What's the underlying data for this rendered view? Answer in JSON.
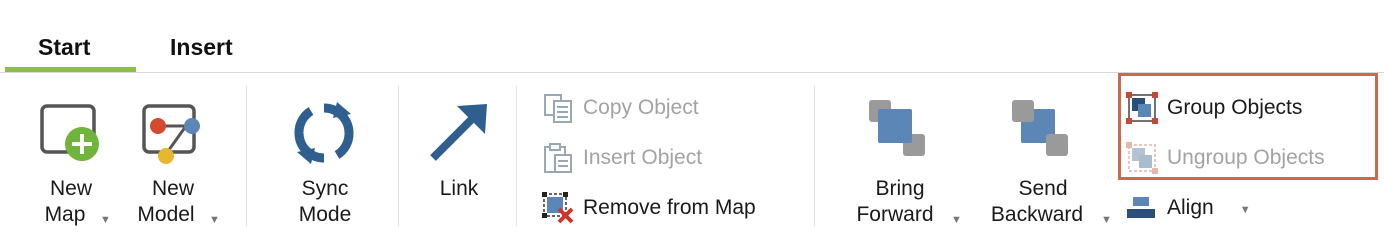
{
  "tabs": [
    {
      "label": "Start",
      "active": true
    },
    {
      "label": "Insert",
      "active": false
    }
  ],
  "colors": {
    "accent": "#8cbf4a",
    "highlight": "#d0674a",
    "icon_blue": "#2f5f8f",
    "disabled": "#a3a3a3"
  },
  "ribbon": {
    "new_map": {
      "line1": "New",
      "line2": "Map",
      "icon": "new-map-icon"
    },
    "new_model": {
      "line1": "New",
      "line2": "Model",
      "icon": "new-model-icon"
    },
    "sync_mode": {
      "line1": "Sync",
      "line2": "Mode",
      "icon": "sync-icon"
    },
    "link": {
      "label": "Link",
      "icon": "link-arrow-icon"
    },
    "copy_object": {
      "label": "Copy Object",
      "enabled": false,
      "icon": "copy-object-icon"
    },
    "insert_object": {
      "label": "Insert Object",
      "enabled": false,
      "icon": "insert-object-icon"
    },
    "remove_from_map": {
      "label": "Remove from Map",
      "enabled": true,
      "icon": "remove-from-map-icon"
    },
    "bring_forward": {
      "line1": "Bring",
      "line2": "Forward",
      "icon": "bring-forward-icon"
    },
    "send_backward": {
      "line1": "Send",
      "line2": "Backward",
      "icon": "send-backward-icon"
    },
    "group_objects": {
      "label": "Group Objects",
      "enabled": true,
      "icon": "group-objects-icon"
    },
    "ungroup_objects": {
      "label": "Ungroup Objects",
      "enabled": false,
      "icon": "ungroup-objects-icon"
    },
    "align": {
      "label": "Align",
      "icon": "align-icon"
    }
  }
}
